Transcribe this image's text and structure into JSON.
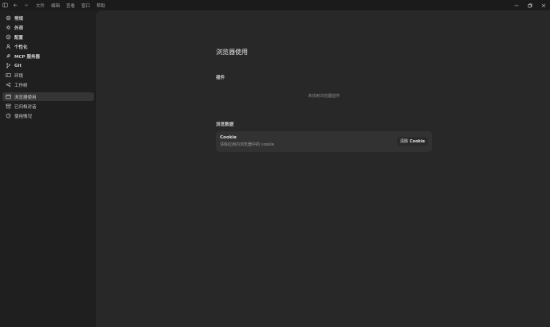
{
  "titlebar": {
    "menu": [
      "文件",
      "编辑",
      "查看",
      "窗口",
      "帮助"
    ]
  },
  "sidebar": {
    "items": [
      {
        "label": "常规",
        "icon": "gear-icon"
      },
      {
        "label": "外观",
        "icon": "sun-icon"
      },
      {
        "label": "配置",
        "icon": "sliders-icon"
      },
      {
        "label": "个性化",
        "icon": "user-icon"
      },
      {
        "label": "MCP 服务器",
        "icon": "plug-icon"
      },
      {
        "label": "Git",
        "icon": "git-branch-icon"
      },
      {
        "label": "环境",
        "icon": "terminal-icon"
      },
      {
        "label": "工作树",
        "icon": "tree-icon"
      },
      {
        "label": "浏览器使用",
        "icon": "browser-icon"
      },
      {
        "label": "已归档对话",
        "icon": "archive-icon"
      },
      {
        "label": "使用情况",
        "icon": "gauge-icon"
      }
    ],
    "active_index": 8
  },
  "main": {
    "title": "浏览器使用",
    "plugins_label": "插件",
    "plugins_empty": "未找到浏览器插件",
    "data_label": "浏览数据",
    "cookie_card": {
      "title": "Cookie",
      "description": "清除应用内浏览器中的 cookie",
      "button_prefix": "清除",
      "button_bold": "Cookie"
    }
  },
  "colors": {
    "sidebar_bg": "#1f1f1f",
    "main_bg": "#282828",
    "active_item": "#353535",
    "card_bg": "#323232"
  }
}
